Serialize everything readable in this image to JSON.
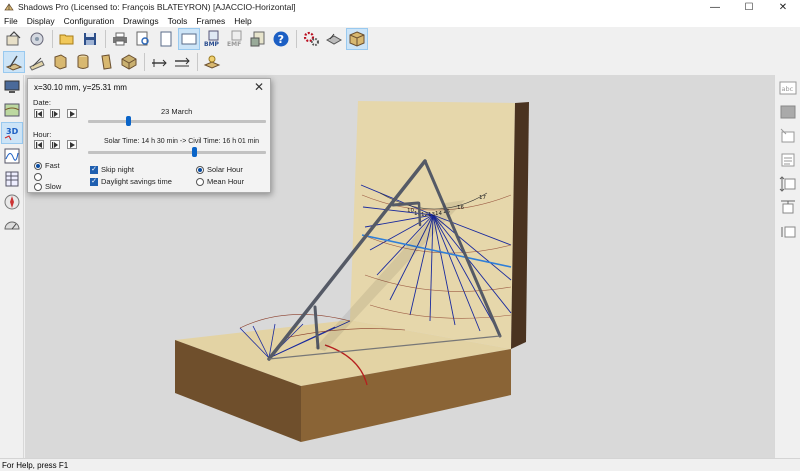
{
  "window": {
    "title": "Shadows Pro  (Licensed to:  François BLATEYRON) [AJACCIO-Horizontal]",
    "minimize": "—",
    "maximize": "☐",
    "close": "✕"
  },
  "menu": [
    "File",
    "Display",
    "Configuration",
    "Drawings",
    "Tools",
    "Frames",
    "Help"
  ],
  "toolbar1": [
    {
      "icon": "open-project-icon"
    },
    {
      "icon": "wizard-icon"
    },
    {
      "icon": "folder-icon"
    },
    {
      "icon": "save-icon"
    },
    {
      "icon": "print-icon"
    },
    {
      "icon": "print-preview-icon"
    },
    {
      "icon": "page-icon"
    },
    {
      "icon": "page-setup-icon"
    },
    {
      "icon": "export-bmp-icon",
      "text": "BMP"
    },
    {
      "icon": "export-emf-icon",
      "text": "EMF"
    },
    {
      "icon": "update-icon"
    },
    {
      "icon": "help-icon",
      "text": "?"
    },
    {
      "icon": "settings-icon"
    },
    {
      "icon": "sundial-3d-icon"
    },
    {
      "icon": "cube-icon"
    }
  ],
  "toolbar2": [
    {
      "icon": "horizontal-dial-icon"
    },
    {
      "icon": "inclined-dial-icon"
    },
    {
      "icon": "box-dial-icon"
    },
    {
      "icon": "cylinder-dial-icon"
    },
    {
      "icon": "column-dial-icon"
    },
    {
      "icon": "polyhedron-icon"
    },
    {
      "icon": "gnomon-length-icon"
    },
    {
      "icon": "gnomon-move-icon"
    },
    {
      "icon": "sun-position-icon"
    }
  ],
  "leftbar": [
    {
      "icon": "monitor-view-icon"
    },
    {
      "icon": "map-view-icon"
    },
    {
      "icon": "3d-view-icon",
      "text": "3D"
    },
    {
      "icon": "curves-view-icon"
    },
    {
      "icon": "table-view-icon"
    },
    {
      "icon": "compass-icon"
    },
    {
      "icon": "protractor-icon"
    }
  ],
  "rightbar": [
    {
      "icon": "text-tool-icon",
      "text": "abc"
    },
    {
      "icon": "fill-tool-icon"
    },
    {
      "icon": "delete-tool-icon"
    },
    {
      "icon": "list-tool-icon"
    },
    {
      "icon": "resize-vertical-icon"
    },
    {
      "icon": "resize-frame-icon"
    },
    {
      "icon": "align-icon"
    }
  ],
  "status": "For Help, press F1",
  "dialog": {
    "coords": "x=30.10 mm, y=25.31 mm",
    "close": "✕",
    "date_label": "Date:",
    "date_value": "23 March",
    "date_position": 0.22,
    "hour_label": "Hour:",
    "hour_value": "Solar Time: 14 h 30 min -> Civil Time: 16 h 01 min",
    "hour_position": 0.6,
    "speed_options": [
      {
        "label": "Fast",
        "selected": true
      },
      {
        "label": "",
        "selected": false
      },
      {
        "label": "Slow",
        "selected": false
      }
    ],
    "skip_night": "Skip night",
    "daylight_saving": "Daylight savings time",
    "solar_hour": "Solar Hour",
    "mean_hour": "Mean Hour"
  },
  "scene": {
    "hour_labels": [
      "10",
      "11",
      "12",
      "13",
      "14",
      "15",
      "16",
      "17"
    ],
    "colors": {
      "dial_face": "#e8d9ad",
      "dial_side": "#7b5a35",
      "hour_line": "#1a2a9e",
      "date_line": "#8a3d2a",
      "equinox_line": "#2f7fd8",
      "gnomon": "#555a66",
      "background": "#d9d9d9"
    }
  }
}
